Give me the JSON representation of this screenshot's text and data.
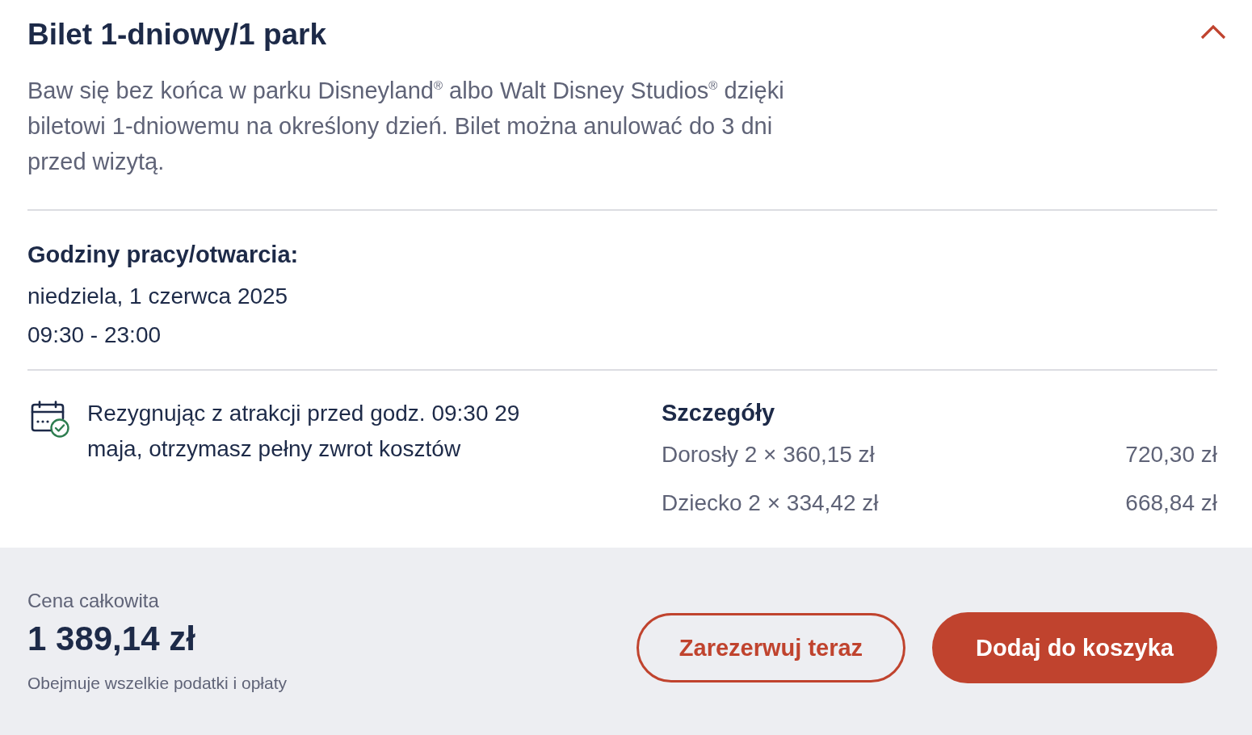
{
  "ticket": {
    "title": "Bilet 1-dniowy/1 park",
    "expanded": true,
    "description": "Baw się bez końca w parku Disneyland$^{®}$ albo Walt Disney Studios$^{®}$ dzięki biletowi 1-dniowemu na określony dzień. Bilet można anulować do 3 dni przed wizytą."
  },
  "opening_hours": {
    "heading": "Godziny pracy/otwarcia:",
    "date": "niedziela, 1 czerwca 2025",
    "hours": "09:30 - 23:00"
  },
  "refund_notice": "Rezygnując z atrakcji przed godz. 09:30 29 maja, otrzymasz pełny zwrot kosztów",
  "details": {
    "heading": "Szczegóły",
    "lines": [
      {
        "label": "Dorosły 2 × 360,15 zł",
        "amount": "720,30 zł"
      },
      {
        "label": "Dziecko 2 × 334,42 zł",
        "amount": "668,84 zł"
      }
    ]
  },
  "total": {
    "label": "Cena całkowita",
    "amount": "1 389,14 zł",
    "note": "Obejmuje wszelkie podatki i opłaty"
  },
  "buttons": [
    {
      "label": "Zarezerwuj teraz",
      "kind": "outline"
    },
    {
      "label": "Dodaj do koszyka",
      "kind": "filled"
    }
  ]
}
